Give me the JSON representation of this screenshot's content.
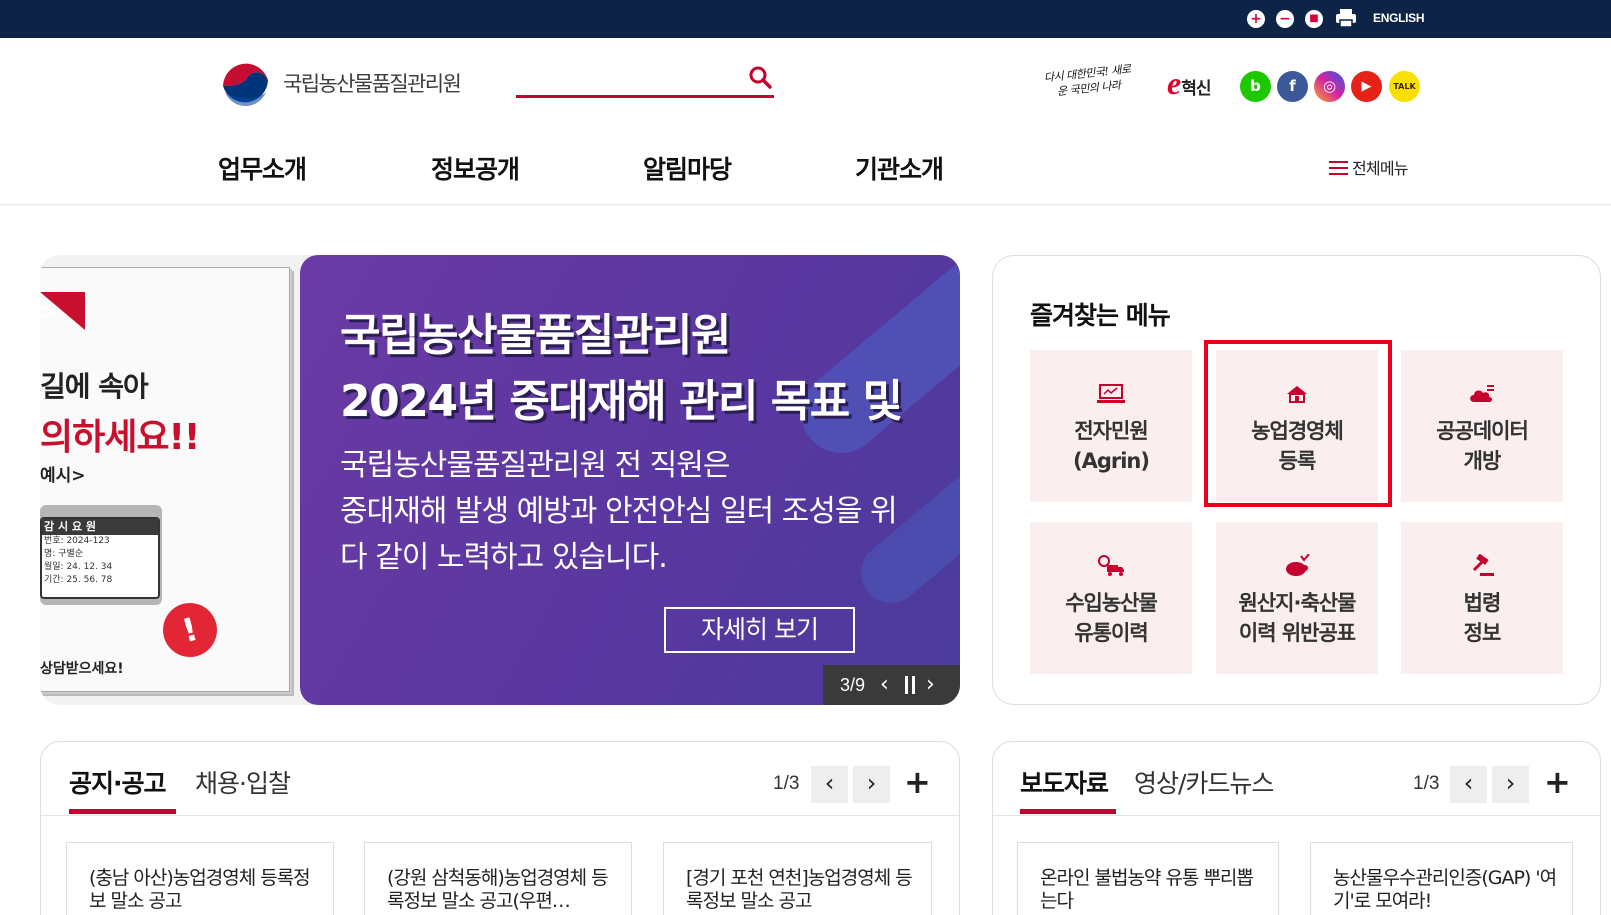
{
  "topbar": {
    "zoom_in": "+",
    "zoom_out": "−",
    "zoom_reset": "■",
    "english": "ENGLISH"
  },
  "header": {
    "logo_text": "국립농산물품질관리원",
    "slogan": "다시 대한민국! 새로운 국민의 나라",
    "einno_e": "e",
    "einno_text": "혁신",
    "sns": [
      {
        "name": "blog",
        "glyph": "b",
        "color": "#1ec800"
      },
      {
        "name": "facebook",
        "glyph": "f",
        "color": "#3b5998"
      },
      {
        "name": "instagram",
        "glyph": "◎",
        "color": "#d6249f"
      },
      {
        "name": "youtube",
        "glyph": "▶",
        "color": "#e62117"
      },
      {
        "name": "kakaotalk",
        "glyph": "TALK",
        "color": "#f9e000"
      }
    ]
  },
  "gnb": {
    "items": [
      "업무소개",
      "정보공개",
      "알림마당",
      "기관소개"
    ],
    "all_menu": "전체메뉴"
  },
  "banner": {
    "prev": {
      "line1": "길에 속아",
      "line2": "의하세요!!",
      "line3": "예시>",
      "card_title": "감 시 요 원",
      "card_lines": [
        "번호: 2024-123",
        "명: 구별순",
        "월일: 24. 12. 34",
        "기간: 25. 56. 78"
      ],
      "bottom": "상담받으세요!"
    },
    "title_line1": "국립농산물품질관리원",
    "title_line2": "2024년 중대재해 관리 목표 및",
    "desc_line1": "국립농산물품질관리원 전 직원은",
    "desc_line2": "중대재해 발생 예방과 안전안심 일터 조성을 위",
    "desc_line3": "다 같이 노력하고 있습니다.",
    "more": "자세히 보기",
    "counter": "3/9"
  },
  "favorites": {
    "title": "즐겨찾는 메뉴",
    "items": [
      {
        "line1": "전자민원",
        "line2": "(Agrin)"
      },
      {
        "line1": "농업경영체",
        "line2": "등록"
      },
      {
        "line1": "공공데이터",
        "line2": "개방"
      },
      {
        "line1": "수입농산물",
        "line2": "유통이력"
      },
      {
        "line1": "원산지·축산물",
        "line2": "이력 위반공표"
      },
      {
        "line1": "법령",
        "line2": "정보"
      }
    ],
    "accent": "#c6002f"
  },
  "notice_board": {
    "tab_active": "공지·공고",
    "tab_inactive": "채용·입찰",
    "page": "1/3",
    "posts": [
      "(충남 아산)농업경영체 등록정보 말소 공고",
      "(강원 삼척동해)농업경영체 등록정보 말소 공고(우편…",
      "[경기 포천 연천]농업경영체 등록정보 말소 공고"
    ]
  },
  "press_board": {
    "tab_active": "보도자료",
    "tab_inactive": "영상/카드뉴스",
    "page": "1/3",
    "posts": [
      "온라인 불법농약 유통 뿌리뽑는다",
      "농산물우수관리인증(GAP) '여기'로 모여라!"
    ]
  }
}
